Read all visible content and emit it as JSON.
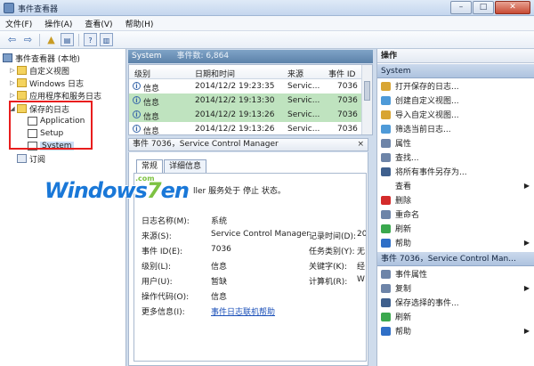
{
  "window": {
    "title": "事件查看器"
  },
  "window_buttons": {
    "minimize": "–",
    "maximize": "□",
    "close": "✕"
  },
  "menu": [
    "文件(F)",
    "操作(A)",
    "查看(V)",
    "帮助(H)"
  ],
  "toolbar_icons": [
    "back-arrow-icon",
    "forward-arrow-icon",
    "up-folder-icon",
    "show-hide-tree-icon",
    "help-icon",
    "show-hide-action-pane-icon"
  ],
  "tree": {
    "root": "事件查看器 (本地)",
    "items": [
      {
        "label": "自定义视图",
        "icon": "folder-icon"
      },
      {
        "label": "Windows 日志",
        "icon": "folder-icon"
      },
      {
        "label": "应用程序和服务日志",
        "icon": "folder-icon"
      },
      {
        "label": "保存的日志",
        "icon": "folder-icon"
      },
      {
        "label": "Application",
        "icon": "log-icon"
      },
      {
        "label": "Setup",
        "icon": "log-icon"
      },
      {
        "label": "System",
        "icon": "log-icon"
      },
      {
        "label": "订阅",
        "icon": "subscription-icon"
      }
    ]
  },
  "log_header": {
    "name": "System",
    "count_label": "事件数: 6,864"
  },
  "events_table": {
    "columns": [
      "级别",
      "日期和时间",
      "来源",
      "事件 ID"
    ],
    "rows": [
      {
        "level": "信息",
        "datetime": "2014/12/2 19:23:35",
        "source": "Servic...",
        "id": "7036",
        "selected": false
      },
      {
        "level": "信息",
        "datetime": "2014/12/2 19:13:30",
        "source": "Servic...",
        "id": "7036",
        "selected": true
      },
      {
        "level": "信息",
        "datetime": "2014/12/2 19:13:26",
        "source": "Servic...",
        "id": "7036",
        "selected": true
      },
      {
        "level": "信息",
        "datetime": "2014/12/2 19:13:26",
        "source": "Servic...",
        "id": "7036",
        "selected": false
      }
    ]
  },
  "detail": {
    "header": "事件 7036，Service Control Manager",
    "close_label": "×",
    "tabs": [
      "常规",
      "详细信息"
    ],
    "description": "ller 服务处于 停止 状态。",
    "fields": {
      "log_name_label": "日志名称(M):",
      "log_name": "系统",
      "source_label": "来源(S):",
      "source": "Service Control Manager",
      "logged_label": "记录时间(D):",
      "logged": "20",
      "event_id_label": "事件 ID(E):",
      "event_id": "7036",
      "task_label": "任务类别(Y):",
      "task": "无",
      "level_label": "级别(L):",
      "level": "信息",
      "keywords_label": "关键字(K):",
      "keywords": "经",
      "user_label": "用户(U):",
      "user": "暂缺",
      "computer_label": "计算机(R):",
      "computer": "W",
      "opcode_label": "操作代码(O):",
      "opcode": "信息",
      "more_info_label": "更多信息(I):",
      "more_info_link": "事件日志联机帮助"
    }
  },
  "watermark": {
    "text_a": "Windows",
    "text_b": "7",
    "text_c": "en",
    "com": ".com"
  },
  "actions": {
    "title": "操作",
    "section1": "System",
    "items1": [
      {
        "label": "打开保存的日志...",
        "icon": "open-log-icon",
        "color": "#d8a533",
        "arrow": ""
      },
      {
        "label": "创建自定义视图...",
        "icon": "filter-icon",
        "color": "#4e9ad8",
        "arrow": ""
      },
      {
        "label": "导入自定义视图...",
        "icon": "import-icon",
        "color": "#d8a533",
        "arrow": ""
      },
      {
        "label": "筛选当前日志...",
        "icon": "filter-icon",
        "color": "#4e9ad8",
        "arrow": ""
      },
      {
        "label": "属性",
        "icon": "properties-icon",
        "color": "#6d84a8",
        "arrow": ""
      },
      {
        "label": "查找...",
        "icon": "find-icon",
        "color": "#6d84a8",
        "arrow": ""
      },
      {
        "label": "将所有事件另存为...",
        "icon": "save-icon",
        "color": "#3e5f8d",
        "arrow": ""
      },
      {
        "label": "查看",
        "icon": "",
        "color": "",
        "arrow": "▶"
      },
      {
        "label": "删除",
        "icon": "delete-icon",
        "color": "#d42b2b",
        "arrow": ""
      },
      {
        "label": "重命名",
        "icon": "rename-icon",
        "color": "#6d84a8",
        "arrow": ""
      },
      {
        "label": "刷新",
        "icon": "refresh-icon",
        "color": "#3aa84e",
        "arrow": ""
      },
      {
        "label": "帮助",
        "icon": "help-icon",
        "color": "#2f6fc7",
        "arrow": "▶"
      }
    ],
    "section2": "事件 7036，Service Control Man...",
    "items2": [
      {
        "label": "事件属性",
        "icon": "event-properties-icon",
        "color": "#6d84a8",
        "arrow": ""
      },
      {
        "label": "复制",
        "icon": "copy-icon",
        "color": "#6d84a8",
        "arrow": "▶"
      },
      {
        "label": "保存选择的事件...",
        "icon": "save-icon",
        "color": "#3e5f8d",
        "arrow": ""
      },
      {
        "label": "刷新",
        "icon": "refresh-icon",
        "color": "#3aa84e",
        "arrow": ""
      },
      {
        "label": "帮助",
        "icon": "help-icon",
        "color": "#2f6fc7",
        "arrow": "▶"
      }
    ]
  }
}
